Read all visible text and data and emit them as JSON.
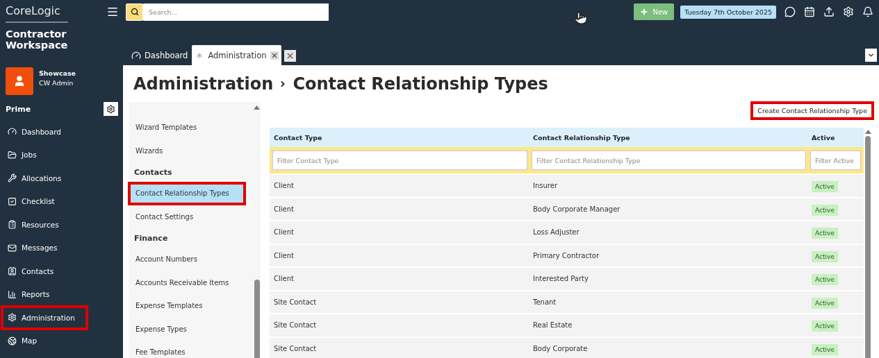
{
  "brand": {
    "company": "CoreLogic",
    "product_line1": "Contractor",
    "product_line2": "Workspace"
  },
  "search": {
    "placeholder": "Search..."
  },
  "new_button": {
    "label": "New"
  },
  "date": "Tuesday 7th October 2025",
  "user": {
    "name": "Showcase",
    "role": "CW Admin"
  },
  "section": "Prime",
  "nav": [
    {
      "label": "Dashboard",
      "highlighted": false
    },
    {
      "label": "Jobs",
      "highlighted": false
    },
    {
      "label": "Allocations",
      "highlighted": false
    },
    {
      "label": "Checklist",
      "highlighted": false
    },
    {
      "label": "Resources",
      "highlighted": false
    },
    {
      "label": "Messages",
      "highlighted": false
    },
    {
      "label": "Contacts",
      "highlighted": false
    },
    {
      "label": "Reports",
      "highlighted": false
    },
    {
      "label": "Administration",
      "highlighted": true
    },
    {
      "label": "Map",
      "highlighted": false
    }
  ],
  "tabs": [
    {
      "label": "Dashboard",
      "selected": false
    },
    {
      "label": "Administration",
      "selected": true
    }
  ],
  "breadcrumb": [
    "Administration",
    "Contact Relationship Types"
  ],
  "admin_menu": [
    {
      "kind": "item",
      "label": "Wizard Templates",
      "selected": false,
      "highlighted": false
    },
    {
      "kind": "item",
      "label": "Wizards",
      "selected": false,
      "highlighted": false
    },
    {
      "kind": "heading",
      "label": "Contacts"
    },
    {
      "kind": "item",
      "label": "Contact Relationship Types",
      "selected": true,
      "highlighted": true
    },
    {
      "kind": "item",
      "label": "Contact Settings",
      "selected": false,
      "highlighted": false
    },
    {
      "kind": "heading",
      "label": "Finance"
    },
    {
      "kind": "item",
      "label": "Account Numbers",
      "selected": false,
      "highlighted": false
    },
    {
      "kind": "item",
      "label": "Accounts Receivable Items",
      "selected": false,
      "highlighted": false
    },
    {
      "kind": "item",
      "label": "Expense Templates",
      "selected": false,
      "highlighted": false
    },
    {
      "kind": "item",
      "label": "Expense Types",
      "selected": false,
      "highlighted": false
    },
    {
      "kind": "item",
      "label": "Fee Templates",
      "selected": false,
      "highlighted": false
    }
  ],
  "create_button": {
    "label": "Create Contact Relationship Type",
    "highlighted": true
  },
  "table": {
    "columns": [
      {
        "label": "Contact Type",
        "filter_placeholder": "Filter Contact Type"
      },
      {
        "label": "Contact Relationship Type",
        "filter_placeholder": "Filter Contact Relationship Type"
      },
      {
        "label": "Active",
        "filter_placeholder": "Filter Active"
      }
    ],
    "rows": [
      {
        "contact_type": "Client",
        "relationship_type": "Insurer",
        "active": "Active"
      },
      {
        "contact_type": "Client",
        "relationship_type": "Body Corporate Manager",
        "active": "Active"
      },
      {
        "contact_type": "Client",
        "relationship_type": "Loss Adjuster",
        "active": "Active"
      },
      {
        "contact_type": "Client",
        "relationship_type": "Primary Contractor",
        "active": "Active"
      },
      {
        "contact_type": "Client",
        "relationship_type": "Interested Party",
        "active": "Active"
      },
      {
        "contact_type": "Site Contact",
        "relationship_type": "Tenant",
        "active": "Active"
      },
      {
        "contact_type": "Site Contact",
        "relationship_type": "Real Estate",
        "active": "Active"
      },
      {
        "contact_type": "Site Contact",
        "relationship_type": "Body Corporate",
        "active": "Active"
      }
    ]
  }
}
